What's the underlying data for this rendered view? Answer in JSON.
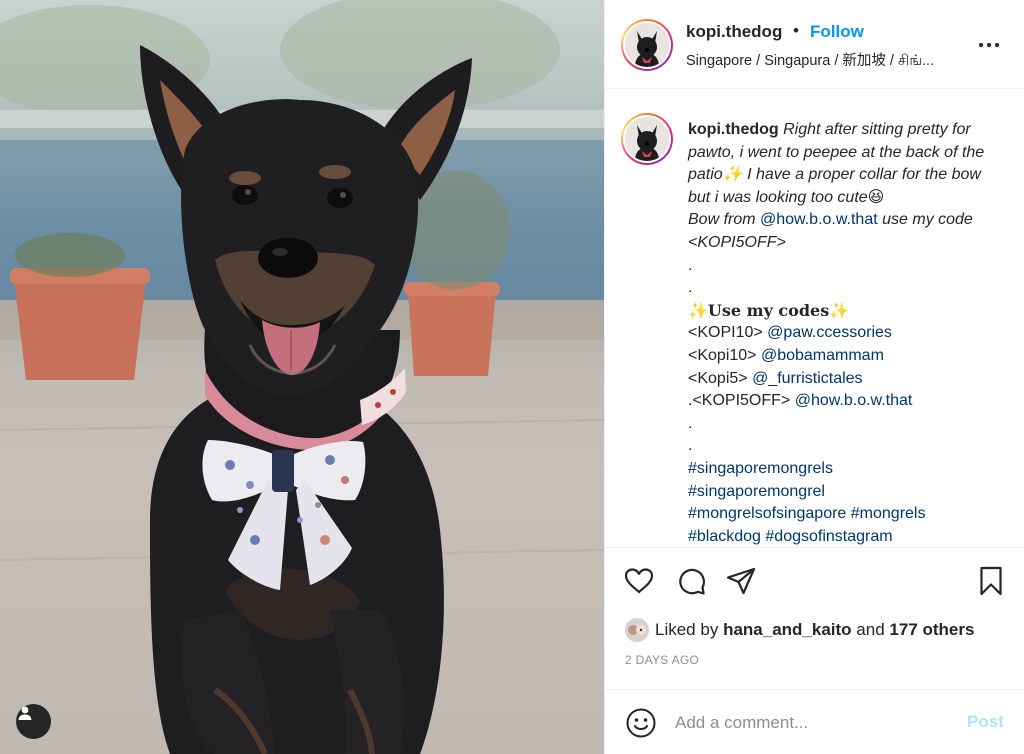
{
  "post": {
    "username": "kopi.thedog",
    "separator": "•",
    "follow_label": "Follow",
    "location": "Singapore / Singapura / 新加坡 / சிங்...",
    "caption": {
      "username": "kopi.thedog",
      "line1": "Right after sitting pretty for",
      "line2": "pawto, i went to peepee at the back of the",
      "line3": "patio✨ I have a proper collar for the bow",
      "line4": "but i was looking too cute😆",
      "line5a": "Bow from ",
      "line5_mention": "@how.b.o.w.that",
      "line5b": " use my code",
      "line6": "<KOPI5OFF>",
      "dot1": ".",
      "dot2": ".",
      "codes_heading": "✨𝐔𝐬𝐞 𝐦𝐲 𝐜𝐨𝐝𝐞𝐬✨",
      "codes": [
        {
          "code": "<KOPI10> ",
          "mention": "@paw.ccessories"
        },
        {
          "code": "<Kopi10> ",
          "mention": "@bobamammam"
        },
        {
          "code": "<Kopi5> ",
          "mention": "@_furristictales"
        },
        {
          "code": ".<KOPI5OFF> ",
          "mention": "@how.b.o.w.that"
        }
      ],
      "dot3": ".",
      "dot4": ".",
      "hashtags": [
        "#singaporemongrels",
        "#singaporemongrel",
        "#mongrelsofsingapore #mongrels",
        "#blackdog #dogsofinstagram"
      ]
    },
    "likes": {
      "prefix": "Liked by ",
      "user": "hana_and_kaito",
      "middle": " and ",
      "others": "177 others"
    },
    "time_ago": "2 DAYS AGO",
    "comment": {
      "placeholder": "Add a comment...",
      "post_label": "Post"
    },
    "icons": {
      "like": "heart-icon",
      "comment": "comment-bubble-icon",
      "share": "paper-plane-icon",
      "save": "bookmark-icon",
      "more": "more-options-icon",
      "emoji": "emoji-smile-icon",
      "tag": "user-tag-icon"
    },
    "colors": {
      "follow": "#0095f6",
      "mention": "#00376b",
      "post_disabled": "#b2dffc"
    }
  }
}
